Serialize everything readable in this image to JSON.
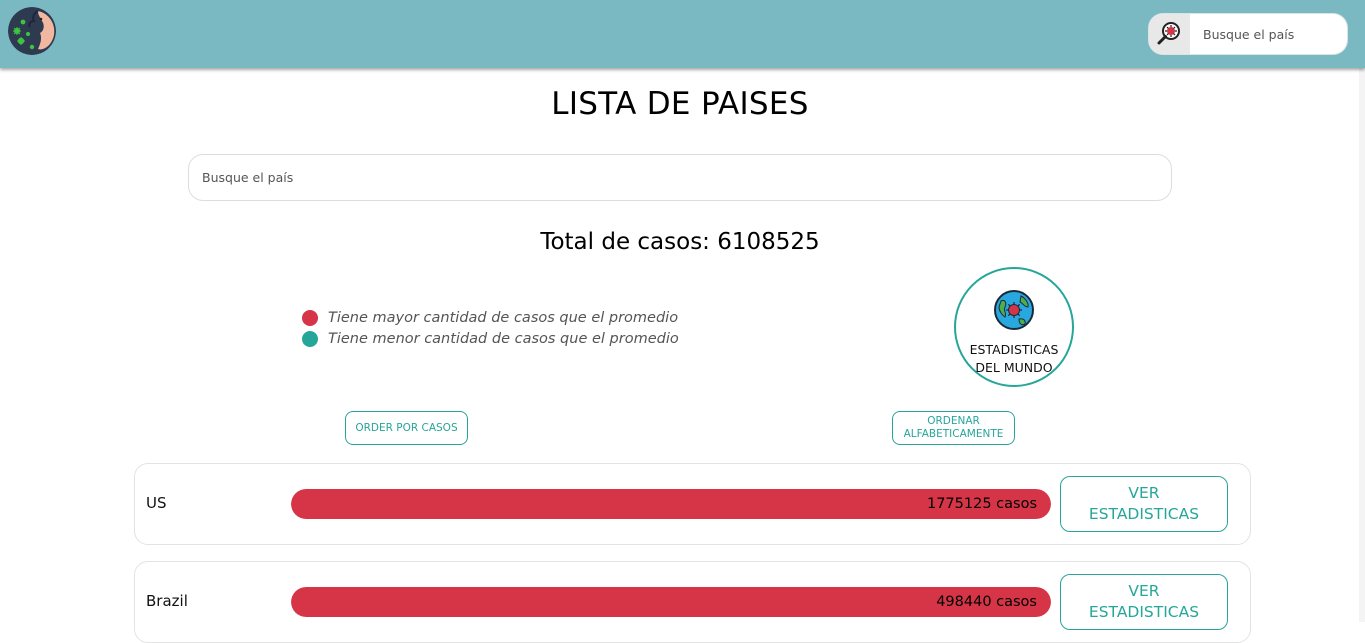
{
  "nav": {
    "search_placeholder": "Busque el país",
    "logo_icon": "covid-person-sneeze-icon",
    "search_icon": "virus-magnifier-icon",
    "bg_color": "#7ab9c1"
  },
  "page": {
    "title": "LISTA DE PAISES",
    "search_placeholder": "Busque el país",
    "total_label": "Total de casos: 6108525"
  },
  "legend": {
    "items": [
      {
        "color": "#d63447",
        "text": "Tiene mayor cantidad de casos que el promedio"
      },
      {
        "color": "#26a69a",
        "text": "Tiene menor cantidad de casos que el promedio"
      }
    ]
  },
  "world_button": {
    "label_line1": "ESTADISTICAS",
    "label_line2": "DEL MUNDO",
    "icon": "globe-virus-icon"
  },
  "sort": {
    "by_cases": "ORDER POR CASOS",
    "alpha_line1": "ORDENAR",
    "alpha_line2": "ALFABETICAMENTE"
  },
  "countries": [
    {
      "name": "US",
      "cases_label": "1775125 casos",
      "bar_fill": 1.0,
      "bar_color": "#d63447",
      "button_line1": "VER",
      "button_line2": "ESTADISTICAS"
    },
    {
      "name": "Brazil",
      "cases_label": "498440 casos",
      "bar_fill": 1.0,
      "bar_color": "#d63447",
      "button_line1": "VER",
      "button_line2": "ESTADISTICAS"
    }
  ]
}
